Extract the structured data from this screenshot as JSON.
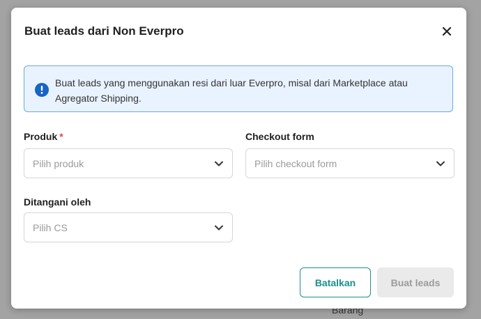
{
  "background": {
    "partial_text": "Barang"
  },
  "modal": {
    "title": "Buat leads dari Non Everpro",
    "close_icon": "close-icon",
    "alert": {
      "icon": "info-exclamation-icon",
      "text": "Buat leads yang menggunakan resi dari luar Everpro, misal dari Marketplace atau Agregator Shipping."
    },
    "fields": {
      "produk": {
        "label": "Produk",
        "required_mark": "*",
        "placeholder": "Pilih produk"
      },
      "checkout_form": {
        "label": "Checkout form",
        "placeholder": "Pilih checkout form"
      },
      "ditangani_oleh": {
        "label": "Ditangani oleh",
        "placeholder": "Pilih CS"
      }
    },
    "buttons": {
      "cancel": "Batalkan",
      "submit": "Buat leads"
    }
  },
  "colors": {
    "accent": "#1b8f8f",
    "info_bg": "#e9f3ff",
    "info_border": "#6aa8e8",
    "required": "#e0454f",
    "disabled_bg": "#eaeaea"
  }
}
